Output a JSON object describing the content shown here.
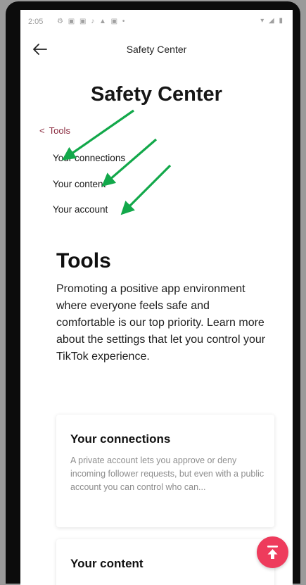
{
  "status_bar": {
    "time": "2:05",
    "icons": "⚙ ▣ ▣ ♪ ▲ ▣ •",
    "right": "▾ ◢ ▮"
  },
  "header": {
    "title": "Safety Center"
  },
  "hero": {
    "title": "Safety Center"
  },
  "breadcrumb": {
    "chevron": "<",
    "label": "Tools"
  },
  "subnav": {
    "items": [
      {
        "label": "Your connections"
      },
      {
        "label": "Your content"
      },
      {
        "label": "Your account"
      }
    ]
  },
  "tools_section": {
    "title": "Tools",
    "description": "Promoting a positive app environment where everyone feels safe and comfortable is our top priority. Learn more about the settings that let you control your TikTok experience."
  },
  "cards": [
    {
      "title": "Your connections",
      "description": "A private account lets you approve or deny incoming follower requests, but even with a public account you can control who can..."
    },
    {
      "title": "Your content"
    }
  ],
  "colors": {
    "accent": "#ee3b5c",
    "breadcrumb": "#8a2a3e",
    "annotation_arrow": "#12a84a"
  },
  "icons": {
    "back": "arrow-left-icon",
    "scroll_top": "arrow-up-to-top-icon"
  }
}
